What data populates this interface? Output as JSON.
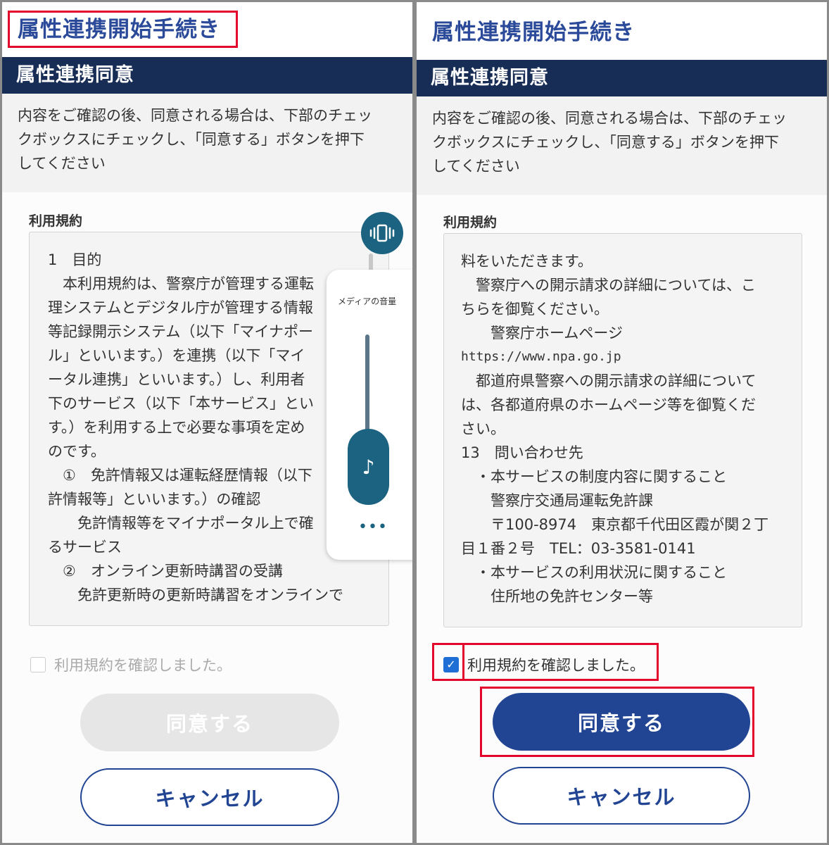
{
  "left": {
    "title": "属性連携開始手続き",
    "section_header": "属性連携同意",
    "instruction": [
      "内容をご確認の後、同意される場合は、下部のチェッ",
      "クボックスにチェックし、「同意する」ボタンを押下",
      "してください"
    ],
    "terms_label": "利用規約",
    "terms_lines": [
      "1　目的",
      "　本利用規約は、警察庁が管理する運転",
      "理システムとデジタル庁が管理する情報",
      "等記録開示システム（以下「マイナポー",
      "ル」といいます。）を連携（以下「マイ",
      "ータル連携」といいます。）し、利用者",
      "下のサービス（以下「本サービス」とい",
      "す。）を利用する上で必要な事項を定め",
      "のです。",
      "　①　免許情報又は運転経歴情報（以下",
      "許情報等」といいます。）の確認",
      "　　免許情報等をマイナポータル上で確",
      "るサービス",
      "　②　オンライン更新時講習の受講",
      "　　免許更新時の更新時講習をオンラインで"
    ],
    "checkbox_label": "利用規約を確認しました。",
    "checkbox_checked": false,
    "agree_button": "同意する",
    "cancel_button": "キャンセル"
  },
  "right": {
    "title": "属性連携開始手続き",
    "section_header": "属性連携同意",
    "instruction": [
      "内容をご確認の後、同意される場合は、下部のチェッ",
      "クボックスにチェックし、「同意する」ボタンを押下",
      "してください"
    ],
    "terms_label": "利用規約",
    "terms_lines": [
      "料をいただきます。",
      "　警察庁への開示請求の詳細については、こ",
      "ちらを御覧ください。",
      "　　警察庁ホームページ",
      "https://www.npa.go.jp",
      "　都道府県警察への開示請求の詳細について",
      "は、各都道府県のホームページ等を御覧くだ",
      "さい。",
      "13　問い合わせ先",
      "　・本サービスの制度内容に関すること",
      "　　警察庁交通局運転免許課",
      "　　〒100-8974　東京都千代田区霞が関２丁",
      "目１番２号　TEL：03-3581-0141",
      "　・本サービスの利用状況に関すること",
      "　　住所地の免許センター等"
    ],
    "checkbox_label": "利用規約を確認しました。",
    "checkbox_checked": true,
    "agree_button": "同意する",
    "cancel_button": "キャンセル"
  },
  "volume_overlay": {
    "label": "メディアの音量",
    "level": 0.3,
    "icon": "music-note-icon",
    "more_icon": "more-horizontal-icon",
    "vibrate_icon": "vibrate-icon"
  },
  "colors": {
    "title": "#2b4a9a",
    "header_bg": "#172d55",
    "highlight": "#e4062a",
    "primary_button": "#224593",
    "checkbox_checked": "#1e6ed6",
    "overlay_accent": "#1b6380"
  }
}
